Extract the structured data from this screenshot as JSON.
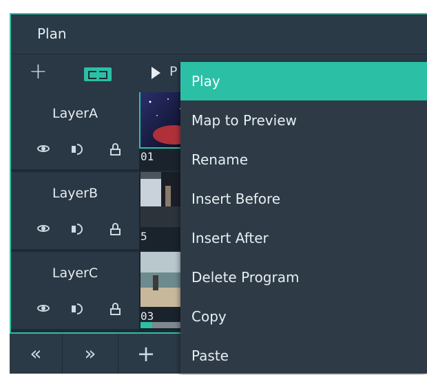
{
  "window": {
    "title": "Plan"
  },
  "toolbar": {
    "add_icon": "plus-icon",
    "link_icon": "link-icon",
    "play_icon": "play-icon",
    "play_label_partial": "P"
  },
  "layers": [
    {
      "name": "LayerA",
      "thumb_label": "01"
    },
    {
      "name": "LayerB",
      "thumb_label": "5"
    },
    {
      "name": "LayerC",
      "thumb_label": "03"
    }
  ],
  "layer_icons": [
    "eye-icon",
    "speaker-icon",
    "lock-icon"
  ],
  "layer_c_progress": 0.25,
  "bottom_bar": {
    "prev_label": "«",
    "next_label": "»",
    "add_label": "+"
  },
  "context_menu": {
    "items": [
      {
        "label": "Play",
        "active": true
      },
      {
        "label": "Map to Preview"
      },
      {
        "label": "Rename"
      },
      {
        "label": "Insert Before"
      },
      {
        "label": "Insert After"
      },
      {
        "label": "Delete Program"
      },
      {
        "label": "Copy"
      },
      {
        "label": "Paste"
      }
    ]
  },
  "colors": {
    "accent": "#2bc0a6",
    "panel": "#2b3a47",
    "background": "#1f2a35",
    "menu": "#2e3b47"
  }
}
